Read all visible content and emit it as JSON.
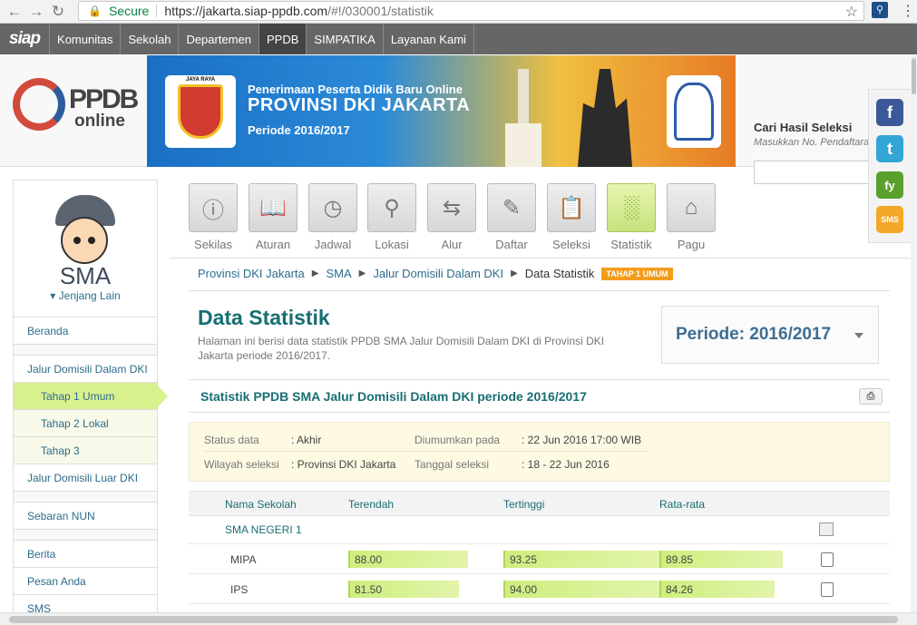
{
  "browser": {
    "secure_label": "Secure",
    "url_host": "https://jakarta.siap-ppdb.com",
    "url_path": "/#!/030001/statistik"
  },
  "topnav": {
    "brand": "siap",
    "items": [
      "Komunitas",
      "Sekolah",
      "Departemen",
      "PPDB",
      "SIMPATIKA",
      "Layanan Kami"
    ],
    "active": "PPDB"
  },
  "logo": {
    "ppdb": "PPDB",
    "online": "online"
  },
  "banner": {
    "emblem_label": "JAYA RAYA",
    "line1": "Penerimaan Peserta Didik Baru Online",
    "line2": "PROVINSI DKI JAKARTA",
    "line3": "Periode 2016/2017"
  },
  "search": {
    "title": "Cari Hasil Seleksi",
    "placeholder": "Masukkan No. Pendaftaran"
  },
  "social": {
    "fb": "f",
    "tw": "t",
    "fy": "fy",
    "sms": "SMS"
  },
  "sidebar": {
    "level": "SMA",
    "other_level": "Jenjang Lain",
    "items": {
      "beranda": "Beranda",
      "jalur_dki": "Jalur Domisili Dalam DKI",
      "tahap1": "Tahap 1 Umum",
      "tahap2": "Tahap 2 Lokal",
      "tahap3": "Tahap 3",
      "jalur_luar": "Jalur Domisili Luar DKI",
      "sebaran": "Sebaran NUN",
      "berita": "Berita",
      "pesan": "Pesan Anda",
      "sms": "SMS"
    }
  },
  "tabs": [
    {
      "label": "Sekilas",
      "icon": "info-icon"
    },
    {
      "label": "Aturan",
      "icon": "book-icon"
    },
    {
      "label": "Jadwal",
      "icon": "clock-icon"
    },
    {
      "label": "Lokasi",
      "icon": "map-pin-icon"
    },
    {
      "label": "Alur",
      "icon": "flow-icon"
    },
    {
      "label": "Daftar",
      "icon": "pencil-icon"
    },
    {
      "label": "Seleksi",
      "icon": "clipboard-icon"
    },
    {
      "label": "Statistik",
      "icon": "bar-chart-icon"
    },
    {
      "label": "Pagu",
      "icon": "home-icon"
    }
  ],
  "breadcrumb": {
    "items": [
      "Provinsi DKI Jakarta",
      "SMA",
      "Jalur Domisili Dalam DKI"
    ],
    "current": "Data Statistik",
    "badge": "TAHAP 1 UMUM"
  },
  "page": {
    "title": "Data Statistik",
    "description": "Halaman ini berisi data statistik PPDB SMA Jalur Domisili Dalam DKI di Provinsi DKI Jakarta periode 2016/2017.",
    "periode": "Periode: 2016/2017"
  },
  "section": {
    "title": "Statistik PPDB SMA Jalur Domisili Dalam DKI periode 2016/2017"
  },
  "status": {
    "status_label": "Status data",
    "status_value": ": Akhir",
    "announced_label": "Diumumkan pada",
    "announced_value": ": 22 Jun 2016 17:00 WIB",
    "region_label": "Wilayah seleksi",
    "region_value": ": Provinsi DKI Jakarta",
    "date_label": "Tanggal seleksi",
    "date_value": ": 18 - 22 Jun 2016"
  },
  "table": {
    "headers": [
      "Nama Sekolah",
      "Terendah",
      "Tertinggi",
      "Rata-rata"
    ],
    "school": "SMA NEGERI 1",
    "rows": [
      {
        "name": "MIPA",
        "min": "88.00",
        "max": "93.25",
        "avg": "89.85",
        "min_fill": 0.56,
        "max_fill": 0.74,
        "avg_fill": 0.58
      },
      {
        "name": "IPS",
        "min": "81.50",
        "max": "94.00",
        "avg": "84.26",
        "min_fill": 0.52,
        "max_fill": 0.76,
        "avg_fill": 0.54
      }
    ]
  }
}
